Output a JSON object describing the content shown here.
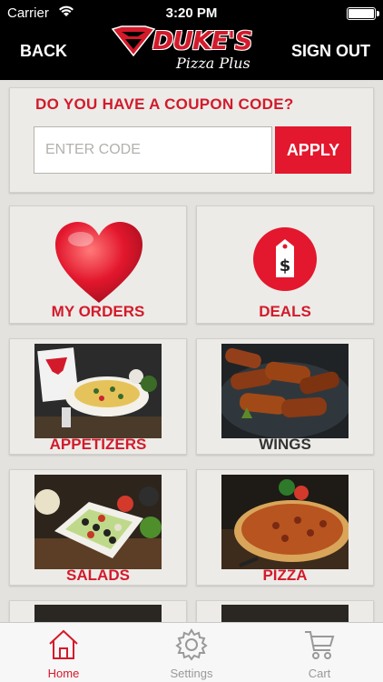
{
  "status_bar": {
    "carrier": "Carrier",
    "time": "3:20 PM"
  },
  "nav": {
    "back_label": "BACK",
    "sign_out_label": "SIGN OUT"
  },
  "logo": {
    "brand": "DUKE'S",
    "sub": "Pizza Plus"
  },
  "coupon": {
    "question": "DO YOU HAVE A COUPON CODE?",
    "code_placeholder": "ENTER CODE",
    "code_value": "",
    "apply_label": "APPLY"
  },
  "tiles": [
    {
      "label": "MY ORDERS",
      "icon": "heart-icon",
      "color": "#d31a2b"
    },
    {
      "label": "DEALS",
      "icon": "price-tag-icon",
      "color": "#d31a2b"
    },
    {
      "label": "APPETIZERS",
      "icon": "appetizers-photo",
      "color": "#d31a2b"
    },
    {
      "label": "WINGS",
      "icon": "wings-photo",
      "color": "#333333"
    },
    {
      "label": "SALADS",
      "icon": "salad-photo",
      "color": "#d31a2b"
    },
    {
      "label": "PIZZA",
      "icon": "pizza-photo",
      "color": "#d31a2b"
    }
  ],
  "deals_tag_symbol": "$",
  "tabs": [
    {
      "label": "Home",
      "icon": "home-icon",
      "active": true
    },
    {
      "label": "Settings",
      "icon": "gear-icon",
      "active": false
    },
    {
      "label": "Cart",
      "icon": "cart-icon",
      "active": false
    }
  ],
  "colors": {
    "accent": "#d31a2b",
    "button": "#e3172d",
    "nav_bg": "#000000",
    "tile_bg": "#ecebe7"
  }
}
